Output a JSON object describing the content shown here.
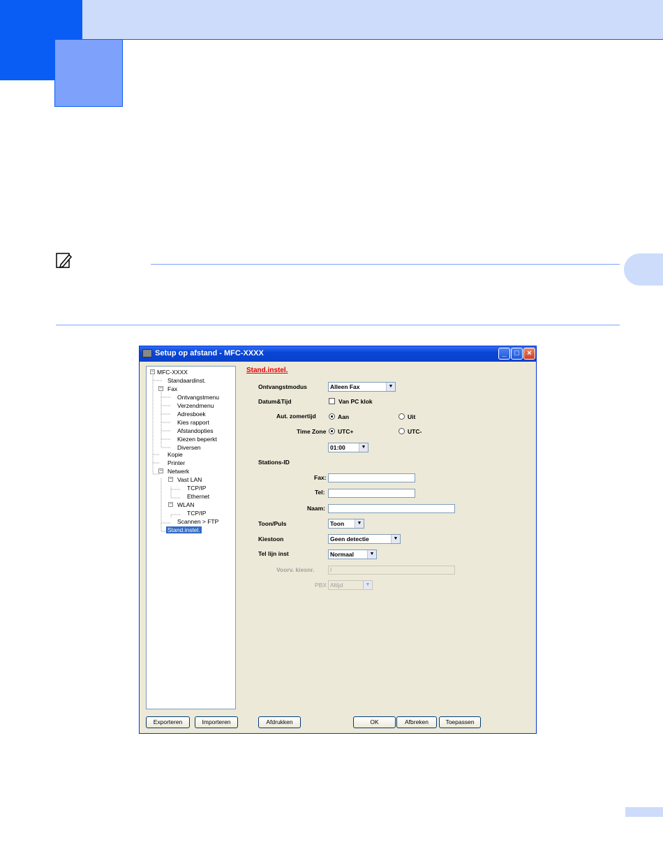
{
  "window": {
    "title": "Setup op afstand - MFC-XXXX",
    "minimize": "_",
    "maximize": "□",
    "close": "×"
  },
  "tree": [
    {
      "label": "MFC-XXXX"
    },
    {
      "label": "Standaardinst."
    },
    {
      "label": "Fax"
    },
    {
      "label": "Ontvangstmenu"
    },
    {
      "label": "Verzendmenu"
    },
    {
      "label": "Adresboek"
    },
    {
      "label": "Kies rapport"
    },
    {
      "label": "Afstandopties"
    },
    {
      "label": "Kiezen beperkt"
    },
    {
      "label": "Diversen"
    },
    {
      "label": "Kopie"
    },
    {
      "label": "Printer"
    },
    {
      "label": "Netwerk"
    },
    {
      "label": "Vast LAN"
    },
    {
      "label": "TCP/IP"
    },
    {
      "label": "Ethernet"
    },
    {
      "label": "WLAN"
    },
    {
      "label": "TCP/IP"
    },
    {
      "label": "Scannen > FTP"
    },
    {
      "label": "Stand.instel."
    }
  ],
  "form": {
    "section_title": "Stand.instel.",
    "ontvangstmodus_label": "Ontvangstmodus",
    "ontvangstmodus_value": "Alleen Fax",
    "datum_label": "Datum&Tijd",
    "van_pc_klok_label": "Van PC klok",
    "zomertijd_label": "Aut. zomertijd",
    "aan_label": "Aan",
    "uit_label": "Uit",
    "timezone_label": "Time Zone",
    "utc_plus_label": "UTC+",
    "utc_minus_label": "UTC-",
    "timezone_value": "01:00",
    "stations_label": "Stations-ID",
    "fax_label": "Fax:",
    "tel_label": "Tel:",
    "naam_label": "Naam:",
    "toonpuls_label": "Toon/Puls",
    "toonpuls_value": "Toon",
    "kiestoon_label": "Kiestoon",
    "kiestoon_value": "Geen detectie",
    "tellijn_label": "Tel lijn inst",
    "tellijn_value": "Normaal",
    "voorv_label": "Voorv. kiesnr.",
    "voorv_value": "I",
    "pbx_label": "PBX",
    "pbx_value": "Altijd"
  },
  "buttons": {
    "exporteren": "Exporteren",
    "importeren": "Importeren",
    "afdrukken": "Afdrukken",
    "ok": "OK",
    "afbreken": "Afbreken",
    "toepassen": "Toepassen"
  },
  "colors": {
    "page_accent": "#0a5df4",
    "page_light": "#cddcfb",
    "window_face": "#ece9d8",
    "selection": "#316ac5",
    "section_title": "#e00000"
  }
}
